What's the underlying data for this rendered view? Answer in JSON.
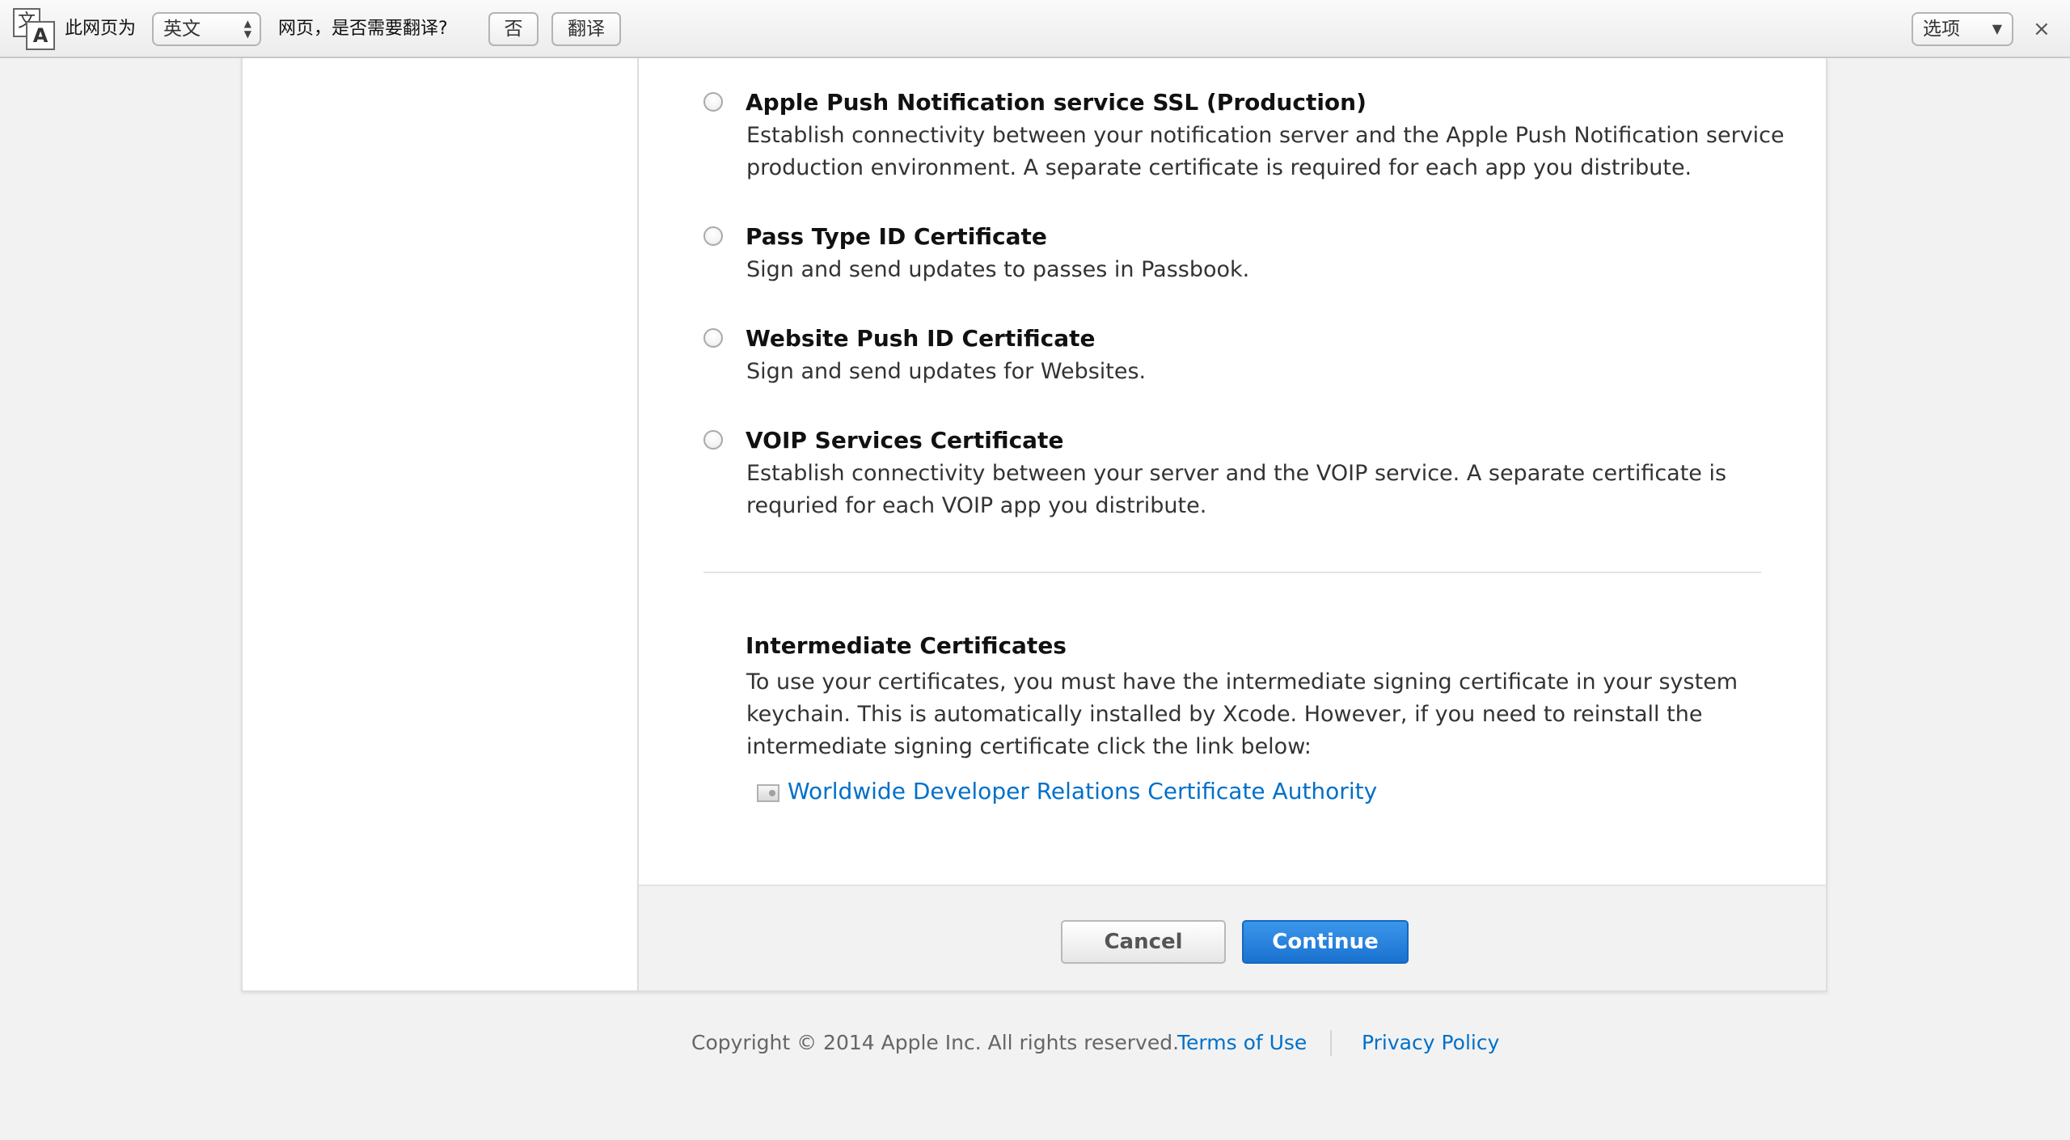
{
  "translate_bar": {
    "icon_glyph_1": "文",
    "icon_glyph_2": "A",
    "page_is_label": "此网页为",
    "language": "英文",
    "prompt": "网页，是否需要翻译?",
    "no_button": "否",
    "translate_button": "翻译",
    "options_label": "选项",
    "close_glyph": "×"
  },
  "options": [
    {
      "title": "Apple Push Notification service SSL (Production)",
      "description": "Establish connectivity between your notification server and the Apple Push Notification service production environment. A separate certificate is required for each app you distribute."
    },
    {
      "title": "Pass Type ID Certificate",
      "description": "Sign and send updates to passes in Passbook."
    },
    {
      "title": "Website Push ID Certificate",
      "description": "Sign and send updates for Websites."
    },
    {
      "title": "VOIP Services Certificate",
      "description": "Establish connectivity between your server and the VOIP service. A separate certificate is requried for each VOIP app you distribute."
    }
  ],
  "intermediate": {
    "title": "Intermediate Certificates",
    "description": "To use your certificates, you must have the intermediate signing certificate in your system keychain. This is automatically installed by Xcode. However, if you need to reinstall the intermediate signing certificate click the link below:",
    "link": "Worldwide Developer Relations Certificate Authority"
  },
  "actions": {
    "cancel": "Cancel",
    "continue": "Continue"
  },
  "footer": {
    "copyright": "Copyright © 2014 Apple Inc. All rights reserved.",
    "terms": "Terms of Use",
    "privacy": "Privacy Policy"
  },
  "colors": {
    "link": "#0070c9",
    "primary_button": "#1a72d0",
    "background": "#f2f2f2"
  }
}
